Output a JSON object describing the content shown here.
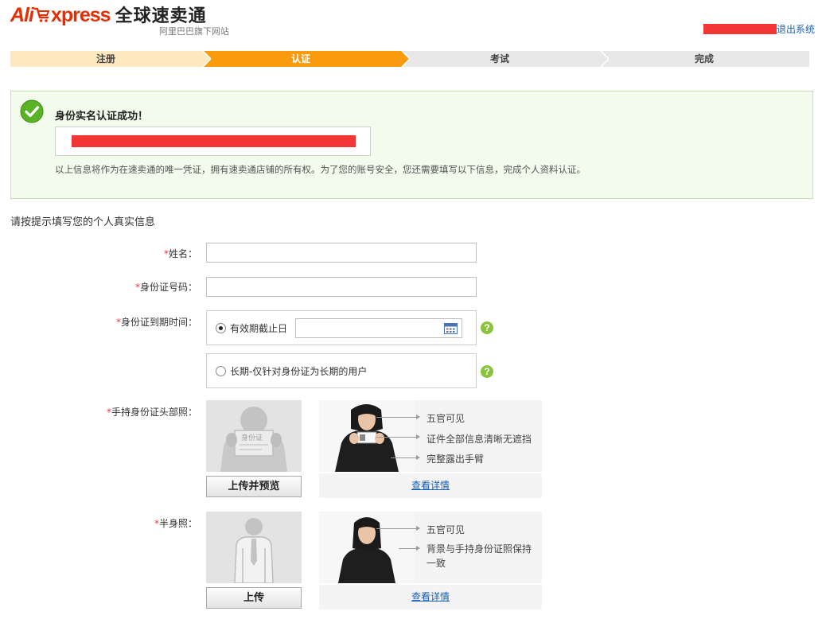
{
  "header": {
    "logo_ali": "Ali",
    "logo_xpress": "xpress",
    "logo_cn": "全球速卖通",
    "logo_sub": "阿里巴巴旗下网站",
    "logout": "退出系统"
  },
  "steps": [
    {
      "label": "注册",
      "state": "done"
    },
    {
      "label": "认证",
      "state": "current"
    },
    {
      "label": "考试",
      "state": "pending"
    },
    {
      "label": "完成",
      "state": "pending"
    }
  ],
  "colors": {
    "brand": "#e62e04",
    "step_current": "#f99b0c",
    "step_done": "#fde8c0",
    "success_bg": "#f2fbec",
    "link": "#1a5fb4",
    "required": "#e4393c",
    "help": "#8ac43f"
  },
  "success": {
    "title": "身份实名认证成功！",
    "description": "以上信息将作为在速卖通的唯一凭证，拥有速卖通店铺的所有权。为了您的账号安全，您还需要填写以下信息，完成个人资料认证。"
  },
  "form": {
    "section_title": "请按提示填写您的个人真实信息",
    "required_mark": "*",
    "name_label": "姓名：",
    "name_value": "",
    "id_label": "身份证号码：",
    "id_value": "",
    "expiry_label": "身份证到期时间：",
    "expiry_option_date": "有效期截止日",
    "expiry_date_value": "",
    "expiry_option_long": "长期-仅针对身份证为长期的用户",
    "expiry_selected": "date",
    "help_symbol": "?",
    "head_photo_label": "手持身份证头部照：",
    "head_photo_card_text": "身份证",
    "head_upload_button": "上传并预览",
    "head_notes": [
      "五官可见",
      "证件全部信息清晰无遮挡",
      "完整露出手臂"
    ],
    "head_detail_link": "查看详情",
    "half_photo_label": "半身照：",
    "half_upload_button": "上传",
    "half_notes": [
      "五官可见",
      "背景与手持身份证照保持一致"
    ],
    "half_detail_link": "查看详情"
  },
  "icons": {
    "logo_cart": "shopping-cart-icon",
    "success": "check-circle-icon",
    "calendar": "calendar-icon",
    "help": "question-circle-icon",
    "head_placeholder": "person-holding-id-icon",
    "half_placeholder": "person-half-body-icon"
  }
}
